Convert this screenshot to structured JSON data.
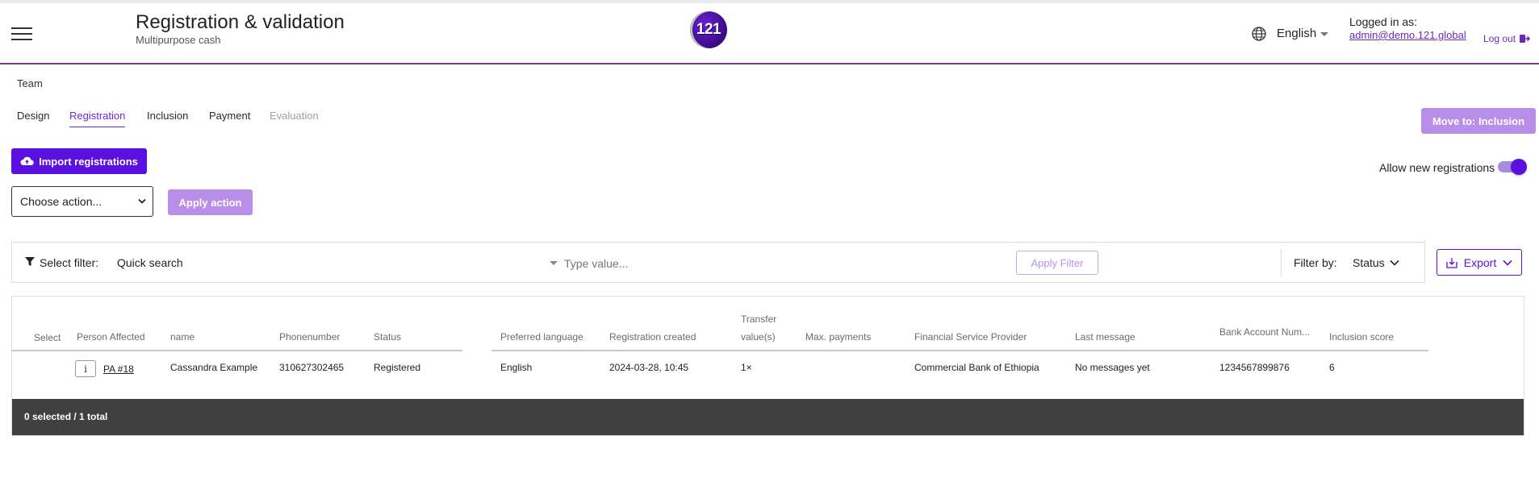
{
  "header": {
    "title": "Registration & validation",
    "subtitle": "Multipurpose cash",
    "logo_text": "121",
    "language": "English",
    "logged_in_label": "Logged in as:",
    "user_email": "admin@demo.121.global",
    "logout_label": "Log out"
  },
  "team_label": "Team",
  "tabs": [
    {
      "label": "Design"
    },
    {
      "label": "Registration"
    },
    {
      "label": "Inclusion"
    },
    {
      "label": "Payment"
    },
    {
      "label": "Evaluation"
    }
  ],
  "actions": {
    "move_button": "Move to: Inclusion",
    "import_button": "Import registrations",
    "allow_new_registrations": "Allow new registrations",
    "choose_action": "Choose action...",
    "apply_action": "Apply action"
  },
  "filter": {
    "label": "Select filter:",
    "quick_search": "Quick search",
    "placeholder": "Type value...",
    "apply": "Apply Filter",
    "filter_by": "Filter by:",
    "status": "Status",
    "export": "Export"
  },
  "table": {
    "headers": {
      "select": "Select",
      "person": "Person Affected",
      "name": "name",
      "phone": "Phonenumber",
      "status": "Status",
      "language": "Preferred language",
      "created": "Registration created",
      "transfer_1": "Transfer",
      "transfer_2": "value(s)",
      "max_payments": "Max. payments",
      "fsp": "Financial Service Provider",
      "last_message": "Last message",
      "bank": "Bank Account Num...",
      "score": "Inclusion score"
    },
    "row": {
      "info": "i",
      "pa": "PA #18",
      "name": "Cassandra Example",
      "phone": "310627302465",
      "status": "Registered",
      "language": "English",
      "created": "2024-03-28, 10:45",
      "transfer": "1×",
      "fsp": "Commercial Bank of Ethiopia",
      "last_message": "No messages yet",
      "bank": "1234567899876",
      "score": "6"
    },
    "footer": "0 selected / 1 total"
  },
  "colors": {
    "primary": "#5b10df",
    "primary_disabled": "#b98ee9",
    "header_border": "#7a3d8c",
    "footer_bg": "#404040"
  },
  "icons": [
    "menu-icon",
    "globe-icon",
    "caret-down-icon",
    "logout-icon",
    "upload-cloud-icon",
    "filter-icon",
    "chevron-down-icon",
    "download-icon"
  ]
}
